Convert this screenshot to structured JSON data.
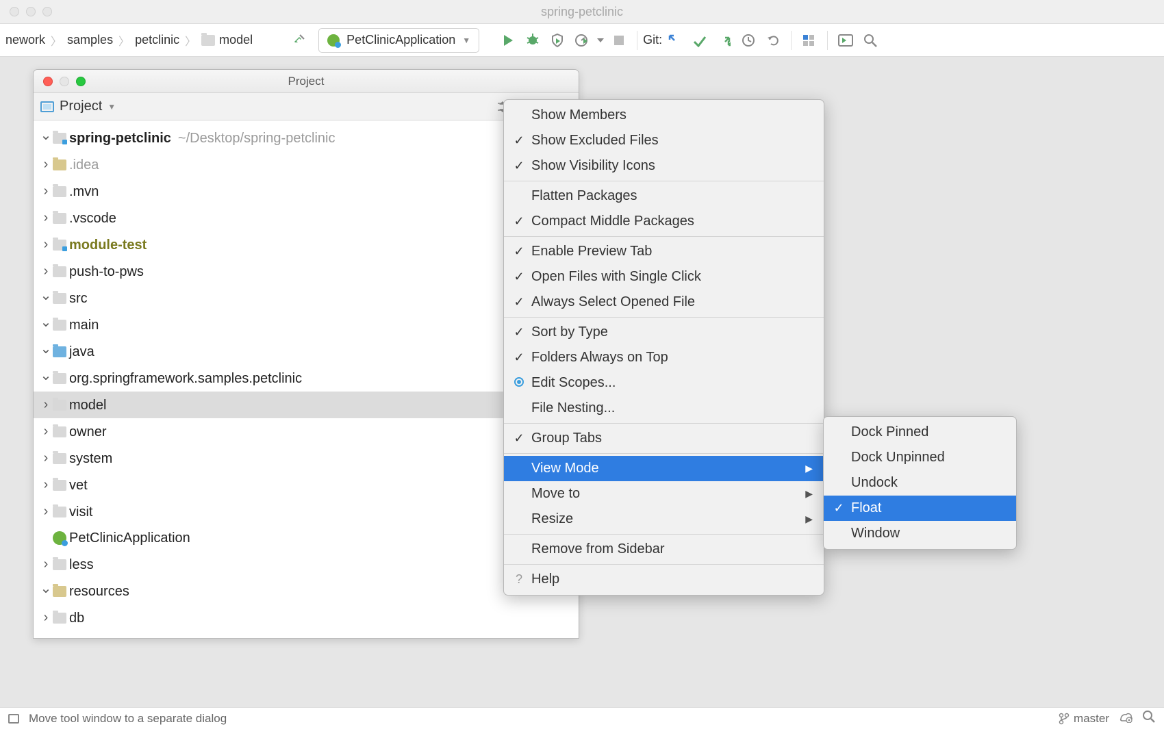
{
  "window": {
    "title": "spring-petclinic"
  },
  "breadcrumb": {
    "items": [
      "nework",
      "samples",
      "petclinic",
      "model"
    ]
  },
  "runConfig": {
    "label": "PetClinicApplication"
  },
  "git": {
    "label": "Git:"
  },
  "projectPanel": {
    "title": "Project",
    "selector": "Project",
    "tree": [
      {
        "depth": 0,
        "arrow": "down",
        "iconType": "folder-mark",
        "label": "spring-petclinic",
        "bold": true,
        "hint": "~/Desktop/spring-petclinic"
      },
      {
        "depth": 1,
        "arrow": "right",
        "iconType": "folder-gold",
        "label": ".idea",
        "cls": "gray"
      },
      {
        "depth": 1,
        "arrow": "right",
        "iconType": "folder",
        "label": ".mvn"
      },
      {
        "depth": 1,
        "arrow": "right",
        "iconType": "folder",
        "label": ".vscode"
      },
      {
        "depth": 1,
        "arrow": "right",
        "iconType": "folder-mark",
        "label": "module-test",
        "cls": "olive"
      },
      {
        "depth": 1,
        "arrow": "right",
        "iconType": "folder",
        "label": "push-to-pws"
      },
      {
        "depth": 1,
        "arrow": "down",
        "iconType": "folder",
        "label": "src"
      },
      {
        "depth": 2,
        "arrow": "down",
        "iconType": "folder",
        "label": "main"
      },
      {
        "depth": 3,
        "arrow": "down",
        "iconType": "folder-blue",
        "label": "java"
      },
      {
        "depth": 4,
        "arrow": "down",
        "iconType": "folder-pkg",
        "label": "org.springframework.samples.petclinic"
      },
      {
        "depth": 5,
        "arrow": "right",
        "iconType": "folder-pkg",
        "label": "model",
        "selected": true
      },
      {
        "depth": 5,
        "arrow": "right",
        "iconType": "folder-pkg",
        "label": "owner"
      },
      {
        "depth": 5,
        "arrow": "right",
        "iconType": "folder-pkg",
        "label": "system"
      },
      {
        "depth": 5,
        "arrow": "right",
        "iconType": "folder-pkg",
        "label": "vet"
      },
      {
        "depth": 5,
        "arrow": "right",
        "iconType": "folder-pkg",
        "label": "visit"
      },
      {
        "depth": 5,
        "arrow": "",
        "iconType": "spring",
        "label": "PetClinicApplication",
        "extraIndent": true
      },
      {
        "depth": 3,
        "arrow": "right",
        "iconType": "folder",
        "label": "less"
      },
      {
        "depth": 3,
        "arrow": "down",
        "iconType": "folder-gold",
        "label": "resources"
      },
      {
        "depth": 4,
        "arrow": "right",
        "iconType": "folder",
        "label": "db"
      }
    ]
  },
  "contextMenu1": {
    "items": [
      {
        "label": "Show Members",
        "chk": ""
      },
      {
        "label": "Show Excluded Files",
        "chk": "✓"
      },
      {
        "label": "Show Visibility Icons",
        "chk": "✓"
      },
      {
        "sep": true
      },
      {
        "label": "Flatten Packages",
        "chk": ""
      },
      {
        "label": "Compact Middle Packages",
        "chk": "✓"
      },
      {
        "sep": true
      },
      {
        "label": "Enable Preview Tab",
        "chk": "✓"
      },
      {
        "label": "Open Files with Single Click",
        "chk": "✓"
      },
      {
        "label": "Always Select Opened File",
        "chk": "✓"
      },
      {
        "sep": true
      },
      {
        "label": "Sort by Type",
        "chk": "✓"
      },
      {
        "label": "Folders Always on Top",
        "chk": "✓"
      },
      {
        "label": "Edit Scopes...",
        "chk": "radio"
      },
      {
        "label": "File Nesting...",
        "chk": ""
      },
      {
        "sep": true
      },
      {
        "label": "Group Tabs",
        "chk": "✓"
      },
      {
        "sep": true
      },
      {
        "label": "View Mode",
        "chk": "",
        "sub": "▶",
        "highlight": true
      },
      {
        "label": "Move to",
        "chk": "",
        "sub": "▶"
      },
      {
        "label": "Resize",
        "chk": "",
        "sub": "▶"
      },
      {
        "sep": true
      },
      {
        "label": "Remove from Sidebar",
        "chk": ""
      },
      {
        "sep": true
      },
      {
        "label": "Help",
        "chk": "?"
      }
    ]
  },
  "contextMenu2": {
    "items": [
      {
        "label": "Dock Pinned",
        "chk": ""
      },
      {
        "label": "Dock Unpinned",
        "chk": ""
      },
      {
        "label": "Undock",
        "chk": ""
      },
      {
        "label": "Float",
        "chk": "✓",
        "highlight": true
      },
      {
        "label": "Window",
        "chk": ""
      }
    ]
  },
  "statusBar": {
    "msg": "Move tool window to a separate dialog",
    "branch": "master"
  }
}
